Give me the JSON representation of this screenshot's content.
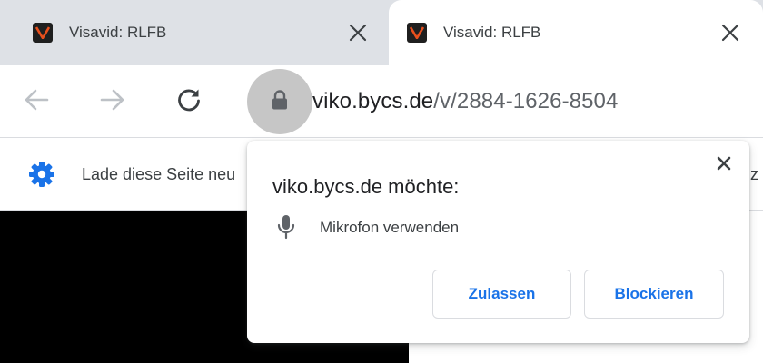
{
  "tabs": [
    {
      "title": "Visavid: RLFB",
      "active": false
    },
    {
      "title": "Visavid: RLFB",
      "active": true
    }
  ],
  "address_bar": {
    "host": "viko.bycs.de",
    "path": "/v/2884-1626-8504"
  },
  "infobar": {
    "message": "Lade diese Seite neu",
    "message_tail": "z"
  },
  "permission_prompt": {
    "title": "viko.bycs.de möchte:",
    "permission": "Mikrofon verwenden",
    "allow_label": "Zulassen",
    "block_label": "Blockieren"
  },
  "icons": {
    "favicon": "visavid-logo-icon",
    "back": "arrow-left-icon",
    "forward": "arrow-right-icon",
    "reload": "reload-icon",
    "site_info": "lock-icon",
    "infobar": "gear-icon",
    "permission": "microphone-icon",
    "close": "close-icon"
  },
  "colors": {
    "tabstrip_bg": "#dee1e6",
    "favicon_accent": "#e8501d",
    "link_blue": "#1a73e8",
    "gear_blue": "#1a73e8",
    "lock_highlight": "#c6c6c6"
  }
}
